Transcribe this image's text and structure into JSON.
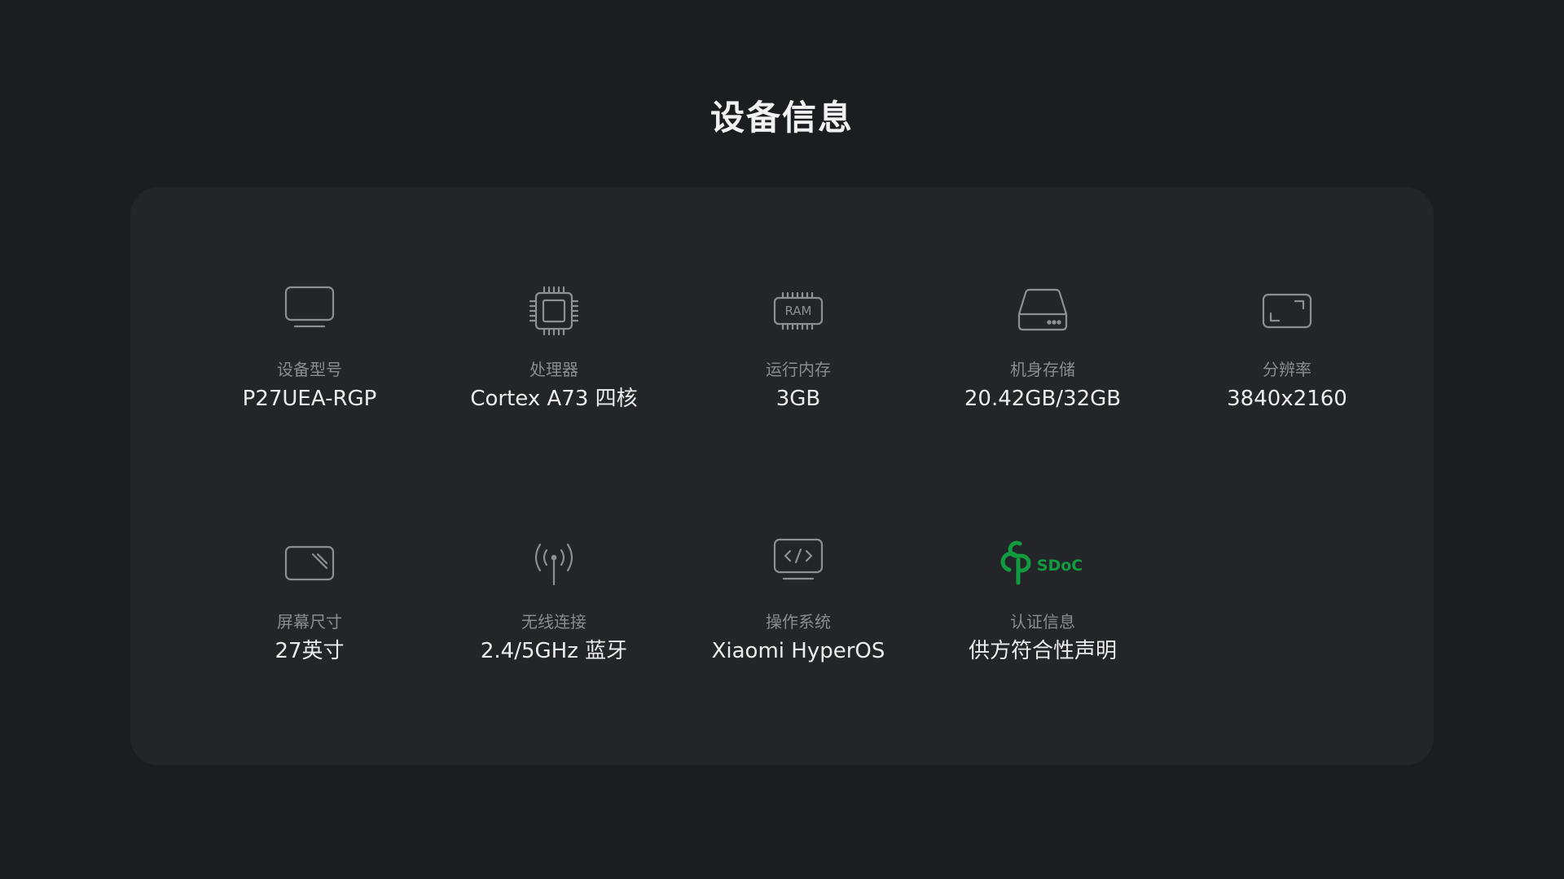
{
  "title": "设备信息",
  "colors": {
    "background": "#1c1d21",
    "card": "#242529",
    "icon_stroke": "#8e8f93",
    "label": "#8b8c90",
    "value": "#ececec",
    "sdoc_green": "#0f9b3e"
  },
  "items": [
    {
      "icon": "monitor-icon",
      "label": "设备型号",
      "value": "P27UEA-RGP"
    },
    {
      "icon": "chip-icon",
      "label": "处理器",
      "value": "Cortex A73 四核"
    },
    {
      "icon": "ram-icon",
      "icon_text": "RAM",
      "label": "运行内存",
      "value": "3GB"
    },
    {
      "icon": "storage-drive-icon",
      "label": "机身存储",
      "value": "20.42GB/32GB"
    },
    {
      "icon": "resolution-frame-icon",
      "label": "分辨率",
      "value": "3840x2160"
    },
    {
      "icon": "screen-size-icon",
      "label": "屏幕尺寸",
      "value": "27英寸"
    },
    {
      "icon": "antenna-icon",
      "label": "无线连接",
      "value": "2.4/5GHz 蓝牙"
    },
    {
      "icon": "code-monitor-icon",
      "label": "操作系统",
      "value": "Xiaomi HyperOS"
    },
    {
      "icon": "sdoc-logo-icon",
      "icon_text": "SDoC",
      "label": "认证信息",
      "value": "供方符合性声明"
    }
  ]
}
